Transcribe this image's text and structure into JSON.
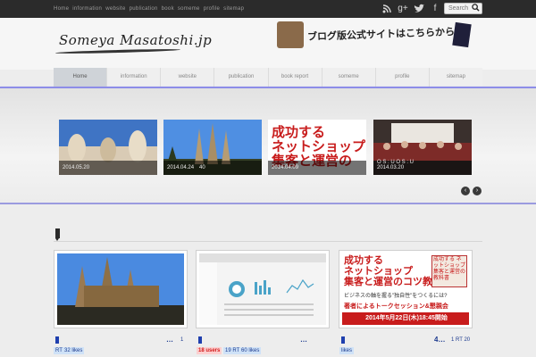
{
  "top_nav": [
    "Home",
    "information",
    "website",
    "publication",
    "book",
    "someme",
    "profile",
    "sitemap"
  ],
  "search": {
    "placeholder": "Search"
  },
  "icons": {
    "rss": "rss-icon",
    "gplus": "google-plus-icon",
    "twitter": "twitter-icon",
    "facebook": "facebook-icon"
  },
  "site": {
    "title": "Someya Masatoshi.jp"
  },
  "banner": {
    "text": "ブログ版公式サイトはこちらから"
  },
  "nav": [
    "Home",
    "information",
    "website",
    "publication",
    "book report",
    "someme",
    "profile",
    "sitemap"
  ],
  "slides": [
    {
      "date": "2014.05.20",
      "extra": ""
    },
    {
      "date": "2014.04.24",
      "extra": "40"
    },
    {
      "date": "2014.04.09",
      "extra": "",
      "title": "成功する\nネットショップ\n集客と運営の"
    },
    {
      "date": "2014.03.20",
      "extra": "O S : U  O S : U"
    }
  ],
  "cards": [
    {
      "meta": "…",
      "count": "1",
      "rt": "RT",
      "likes": "32 likes"
    },
    {
      "meta": "…",
      "count": "",
      "rt": "",
      "users": "18 users",
      "rt2": "19 RT",
      "likes": "60 likes"
    },
    {
      "meta": "4…",
      "count": "1 RT 20",
      "likes": "likes",
      "headline": "成功する\nネットショップ\n集客と運営のコツ教えます!",
      "sub": "ビジネスの軸を握る\"独自性\"をつくるには?",
      "book": "成功する ネットショップ 集客と運営の 教科書",
      "event": "著者によるトークセッション&懇親会",
      "date": "2014年5月22日(木)18:45開始"
    }
  ],
  "colors": {
    "accent": "#8d8de8",
    "topbar": "#2b2b2b",
    "link": "#1d3b8f",
    "users": "#d41a1a"
  }
}
